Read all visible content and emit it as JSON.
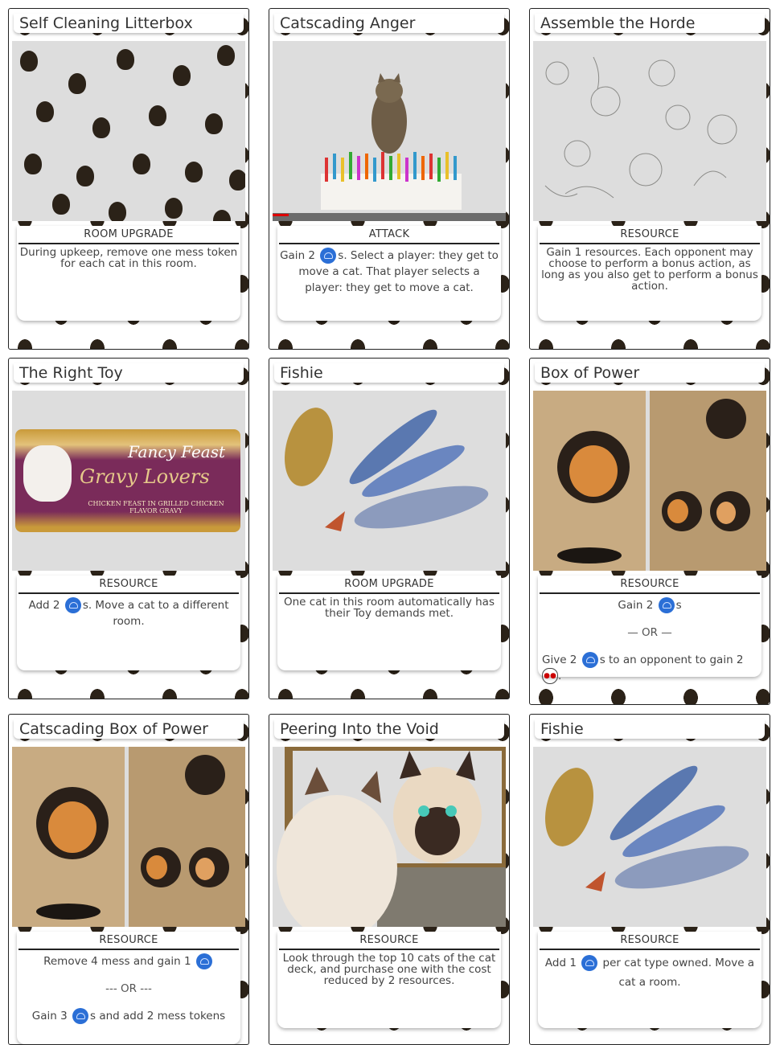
{
  "cards": [
    {
      "title": "Self Cleaning Litterbox",
      "type": "ROOM UPGRADE",
      "art": "paw-print-pattern-icon",
      "body": "During upkeep, remove one mess token for each cat in this room."
    },
    {
      "title": "Catscading Anger",
      "type": "ATTACK",
      "art": "cat-with-dominoes-photo",
      "body_a": "Gain 2",
      "body_b": "s. Select a player: they get to move a cat. That player selects a player: they get to move a cat."
    },
    {
      "title": "Assemble the Horde",
      "type": "RESOURCE",
      "art": "cat-sketches-drawing",
      "body": "Gain 1 resources. Each opponent may choose to perform a bonus action, as long as you also get to perform a bonus action."
    },
    {
      "title": "The Right Toy",
      "type": "RESOURCE",
      "art": "cat-food-can-photo",
      "can_brand": "Fancy Feast",
      "can_line": "Gravy Lovers",
      "can_flavor": "CHICKEN FEAST IN GRILLED CHICKEN FLAVOR GRAVY",
      "body_a": "Add 2",
      "body_b": "s. Move a cat to a different room."
    },
    {
      "title": "Fishie",
      "type": "ROOM UPGRADE",
      "art": "toy-fish-photo",
      "body": "One cat in this room automatically has their Toy demands met."
    },
    {
      "title": "Box of Power",
      "type": "RESOURCE",
      "art": "cardboard-cat-box-photo",
      "body_a": "Gain 2",
      "body_b": "s",
      "or": "— OR —",
      "body_c": "Give 2",
      "body_d": "s to an opponent to gain 2",
      "body_e": "."
    },
    {
      "title": "Catscading Box of Power",
      "type": "RESOURCE",
      "art": "cardboard-cat-box-photo",
      "body_a": "Remove 4 mess and gain 1",
      "or": "--- OR ---",
      "body_c": "Gain 3",
      "body_d": "s and add 2 mess tokens"
    },
    {
      "title": "Peering Into the Void",
      "type": "RESOURCE",
      "art": "cats-mirror-painting",
      "body": "Look through the top 10 cats of the cat deck, and purchase one with the cost reduced by 2 resources."
    },
    {
      "title": "Fishie",
      "type": "RESOURCE",
      "art": "toy-fish-photo",
      "body_a": "Add 1",
      "body_b": "per cat type owned. Move a cat a room."
    }
  ],
  "colors": {
    "token": "#2b6fd6",
    "paw": "#2b2218",
    "border": "#222222"
  }
}
